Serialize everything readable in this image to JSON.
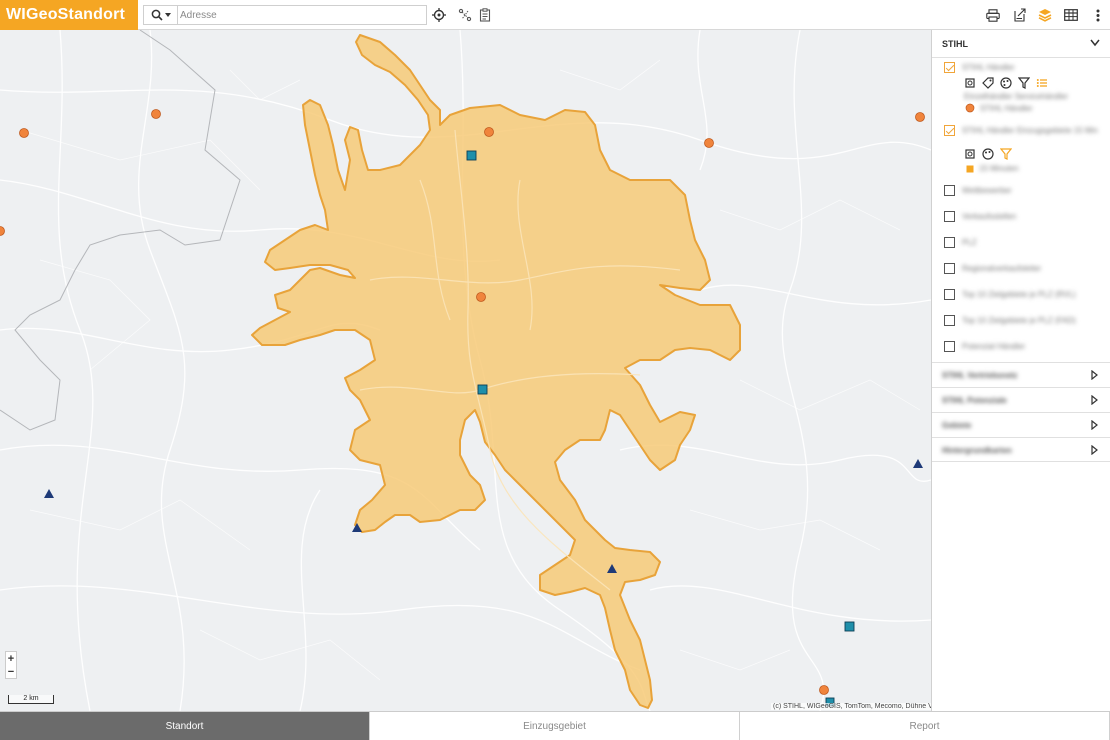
{
  "app": {
    "logo_text": "WIGeoStandort"
  },
  "search": {
    "placeholder": "Adresse",
    "value": ""
  },
  "toolbar_icons": [
    "search-icon",
    "locate-icon",
    "route-icon",
    "clipboard-icon",
    "print-icon",
    "export-icon",
    "layers-icon",
    "table-icon",
    "more-icon"
  ],
  "colors": {
    "accent": "#f5a623",
    "catchment_fill": "#f7c873",
    "catchment_stroke": "#e8a33a",
    "dealer_dot": "#f0843c",
    "square_marker": "#1f8faa",
    "triangle_marker": "#1e3a78",
    "active_tab": "#6b6b6b"
  },
  "map": {
    "scale_label": "2 km",
    "attribution": "(c) STIHL, WIGeoGIS, TomTom, Mecomo, Dühne Verlag",
    "zoom_in": "+",
    "zoom_out": "−"
  },
  "panel": {
    "group_title": "STIHL",
    "layers": [
      {
        "label": "STIHL Händler",
        "checked": true,
        "sub_label": "Einzelhändler Servicehändler",
        "legend": "STIHL Händler"
      },
      {
        "label": "STIHL Händler Einzugsgebiete 15 Min",
        "checked": true,
        "legend": "15 Minuten"
      },
      {
        "label": "Wettbewerber",
        "checked": false
      },
      {
        "label": "Verkaufsstellen",
        "checked": false
      },
      {
        "label": "PLZ",
        "checked": false
      },
      {
        "label": "Regionalverkaufsleiter",
        "checked": false
      },
      {
        "label": "Top 10 Zielgebiete je PLZ (RVL)",
        "checked": false
      },
      {
        "label": "Top 10 Zielgebiete je PLZ (FAD)",
        "checked": false
      },
      {
        "label": "Potenzial Händler",
        "checked": false
      }
    ],
    "sections": [
      "STIHL Vertriebsnetz",
      "STIHL Potenziale",
      "Gebiete",
      "Hintergrundkarten"
    ]
  },
  "tabs": [
    {
      "label": "Standort",
      "active": true
    },
    {
      "label": "Einzugsgebiet",
      "active": false
    },
    {
      "label": "Report",
      "active": false
    }
  ]
}
